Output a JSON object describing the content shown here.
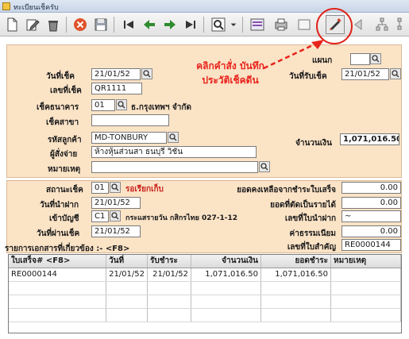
{
  "window": {
    "title": "ทะเบียนเช็ครับ"
  },
  "colors": {
    "form_bg": "#fbe3c6",
    "annotation": "#e8231b",
    "highlight": "#e0241a"
  },
  "toolbar": {
    "buttons": [
      {
        "name": "new-icon"
      },
      {
        "name": "edit-icon"
      },
      {
        "name": "delete-icon"
      },
      {
        "name": "cancel-icon"
      },
      {
        "name": "save-icon"
      },
      {
        "name": "first-icon"
      },
      {
        "name": "prev-icon"
      },
      {
        "name": "next-icon"
      },
      {
        "name": "last-icon"
      },
      {
        "name": "search-icon"
      },
      {
        "name": "dropdown-icon"
      },
      {
        "name": "report-icon"
      },
      {
        "name": "print-icon"
      },
      {
        "name": "record-cheque-history-icon"
      },
      {
        "name": "forward-icon"
      }
    ]
  },
  "annotation": {
    "line1": "คลิกคำสั่ง บันทึก",
    "line2": "ประวัติเช็คดีน"
  },
  "header": {
    "dept_label": "แผนก",
    "dept_value": "",
    "cheque_date_label": "วันที่เช็ค",
    "cheque_date": "21/01/52",
    "received_date_label": "วันที่รับเช็ค",
    "received_date": "21/01/52",
    "cheque_no_label": "เลขที่เช็ค",
    "cheque_no": "QR1111",
    "bank_label": "เช็คธนาคาร",
    "bank_code": "01",
    "bank_name": "ธ.กรุงเทพฯ จำกัด",
    "branch_label": "เช็คสาขา",
    "branch_value": "",
    "customer_label": "รหัสลูกค้า",
    "customer_code": "MD-TONBURY",
    "amount_label": "จำนวนเงิน",
    "amount": "1,071,016.50",
    "payer_label": "ผู้สั่งจ่าย",
    "payer": "ห้างหุ้นส่วนสา ธนบุรี วิชั่น",
    "note_label": "หมายเหตุ",
    "note": ""
  },
  "status": {
    "state_label": "สถานะเช็ค",
    "state_code": "01",
    "state_text": "รอเรียกเก็บ",
    "outstanding_label": "ยอดคงเหลือจากชำระใบเสร็จ",
    "outstanding": "0.00",
    "deposit_date_label": "วันที่นำฝาก",
    "deposit_date": "21/01/52",
    "expense_label": "ยอดที่ตัดเป็นรายได้",
    "expense": "0.00",
    "account_label": "เข้าบัญชี",
    "account_code": "C1",
    "account_name": "กระแสรายวัน กสิกรไทย 027-1-12",
    "deposit_slip_label": "เลขที่ใบนำฝาก",
    "deposit_slip": "~",
    "pass_date_label": "วันที่ผ่านเช็ค",
    "pass_date": "21/01/52",
    "fee_label": "ค่าธรรมเนียม",
    "fee": "0.00",
    "receipt_label": "เลขที่ใบสำคัญ",
    "receipt": "RE0000144"
  },
  "related": {
    "label": "รายการเอกสารที่เกี่ยวข้อง :-  <F8>"
  },
  "grid": {
    "columns": [
      "ใบเสร็จ# <F8>",
      "วันที่",
      "รับชำระ",
      "จำนวนเงิน",
      "ยอดชำระ",
      "หมายเหตุ"
    ],
    "rows": [
      [
        "RE0000144",
        "21/01/52",
        "21/01/52",
        "1,071,016.50",
        "1,071,016.50",
        ""
      ]
    ]
  }
}
